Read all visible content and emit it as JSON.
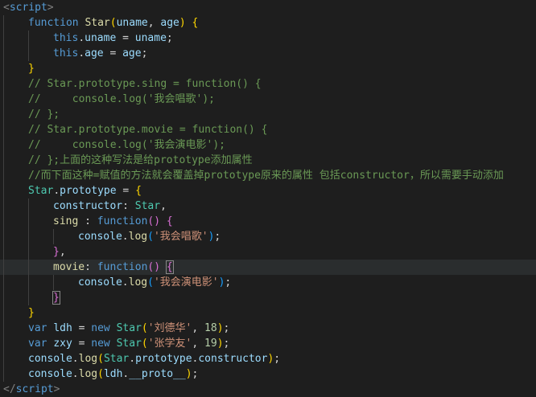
{
  "editor": {
    "language": "javascript",
    "lines": [
      {
        "indent": 0,
        "tokens": [
          [
            "tok-tag",
            "<"
          ],
          [
            "tok-tagname",
            "script"
          ],
          [
            "tok-tag",
            ">"
          ]
        ]
      },
      {
        "indent": 1,
        "tokens": [
          [
            "tok-kw",
            "function "
          ],
          [
            "tok-fn",
            "Star"
          ],
          [
            "tok-b1",
            "("
          ],
          [
            "tok-var",
            "uname"
          ],
          [
            "tok-pun",
            ", "
          ],
          [
            "tok-var",
            "age"
          ],
          [
            "tok-b1",
            ")"
          ],
          [
            "tok-pun",
            " "
          ],
          [
            "tok-b1",
            "{"
          ]
        ]
      },
      {
        "indent": 2,
        "tokens": [
          [
            "tok-kw",
            "this"
          ],
          [
            "tok-pun",
            "."
          ],
          [
            "tok-prop",
            "uname"
          ],
          [
            "tok-pun",
            " = "
          ],
          [
            "tok-var",
            "uname"
          ],
          [
            "tok-pun",
            ";"
          ]
        ]
      },
      {
        "indent": 2,
        "tokens": [
          [
            "tok-kw",
            "this"
          ],
          [
            "tok-pun",
            "."
          ],
          [
            "tok-prop",
            "age"
          ],
          [
            "tok-pun",
            " = "
          ],
          [
            "tok-var",
            "age"
          ],
          [
            "tok-pun",
            ";"
          ]
        ]
      },
      {
        "indent": 1,
        "tokens": [
          [
            "tok-b1",
            "}"
          ]
        ]
      },
      {
        "indent": 1,
        "tokens": [
          [
            "tok-cm",
            "// Star.prototype.sing = function() {"
          ]
        ]
      },
      {
        "indent": 1,
        "tokens": [
          [
            "tok-cm",
            "//     console.log('我会唱歌');"
          ]
        ]
      },
      {
        "indent": 1,
        "tokens": [
          [
            "tok-cm",
            "// };"
          ]
        ]
      },
      {
        "indent": 1,
        "tokens": [
          [
            "tok-cm",
            "// Star.prototype.movie = function() {"
          ]
        ]
      },
      {
        "indent": 1,
        "tokens": [
          [
            "tok-cm",
            "//     console.log('我会演电影');"
          ]
        ]
      },
      {
        "indent": 1,
        "tokens": [
          [
            "tok-cm",
            "// };上面的这种写法是给prototype添加属性"
          ]
        ]
      },
      {
        "indent": 1,
        "tokens": [
          [
            "tok-cm",
            "//而下面这种=赋值的方法就会覆盖掉prototype原来的属性 包括constructor，所以需要手动添加"
          ]
        ]
      },
      {
        "indent": 1,
        "tokens": [
          [
            "tok-cls",
            "Star"
          ],
          [
            "tok-pun",
            "."
          ],
          [
            "tok-prop",
            "prototype"
          ],
          [
            "tok-pun",
            " = "
          ],
          [
            "tok-b1",
            "{"
          ]
        ]
      },
      {
        "indent": 2,
        "tokens": [
          [
            "tok-prop",
            "constructor"
          ],
          [
            "tok-pun",
            ": "
          ],
          [
            "tok-cls",
            "Star"
          ],
          [
            "tok-pun",
            ","
          ]
        ]
      },
      {
        "indent": 2,
        "tokens": [
          [
            "tok-fn",
            "sing"
          ],
          [
            "tok-pun",
            " : "
          ],
          [
            "tok-kw",
            "function"
          ],
          [
            "tok-b2",
            "()"
          ],
          [
            "tok-pun",
            " "
          ],
          [
            "tok-b2",
            "{"
          ]
        ]
      },
      {
        "indent": 3,
        "tokens": [
          [
            "tok-var",
            "console"
          ],
          [
            "tok-pun",
            "."
          ],
          [
            "tok-fn",
            "log"
          ],
          [
            "tok-b3",
            "("
          ],
          [
            "tok-str",
            "'我会唱歌'"
          ],
          [
            "tok-b3",
            ")"
          ],
          [
            "tok-pun",
            ";"
          ]
        ]
      },
      {
        "indent": 2,
        "tokens": [
          [
            "tok-b2",
            "}"
          ],
          [
            "tok-pun",
            ","
          ]
        ]
      },
      {
        "indent": 2,
        "active": true,
        "tokens": [
          [
            "tok-fn",
            "movie"
          ],
          [
            "tok-pun",
            ": "
          ],
          [
            "tok-kw",
            "function"
          ],
          [
            "tok-b2",
            "()"
          ],
          [
            "tok-pun",
            " "
          ],
          [
            "tok-b2 cursor-box",
            "{"
          ]
        ]
      },
      {
        "indent": 3,
        "tokens": [
          [
            "tok-var",
            "console"
          ],
          [
            "tok-pun",
            "."
          ],
          [
            "tok-fn",
            "log"
          ],
          [
            "tok-b3",
            "("
          ],
          [
            "tok-str",
            "'我会演电影'"
          ],
          [
            "tok-b3",
            ")"
          ],
          [
            "tok-pun",
            ";"
          ]
        ]
      },
      {
        "indent": 2,
        "tokens": [
          [
            "tok-b2 cursor-box",
            "}"
          ]
        ]
      },
      {
        "indent": 1,
        "tokens": [
          [
            "tok-b1",
            "}"
          ]
        ]
      },
      {
        "indent": 1,
        "tokens": [
          [
            "tok-kw",
            "var "
          ],
          [
            "tok-var",
            "ldh"
          ],
          [
            "tok-pun",
            " = "
          ],
          [
            "tok-kw",
            "new "
          ],
          [
            "tok-cls",
            "Star"
          ],
          [
            "tok-b1",
            "("
          ],
          [
            "tok-str",
            "'刘德华'"
          ],
          [
            "tok-pun",
            ", "
          ],
          [
            "tok-num",
            "18"
          ],
          [
            "tok-b1",
            ")"
          ],
          [
            "tok-pun",
            ";"
          ]
        ]
      },
      {
        "indent": 1,
        "tokens": [
          [
            "tok-kw",
            "var "
          ],
          [
            "tok-var",
            "zxy"
          ],
          [
            "tok-pun",
            " = "
          ],
          [
            "tok-kw",
            "new "
          ],
          [
            "tok-cls",
            "Star"
          ],
          [
            "tok-b1",
            "("
          ],
          [
            "tok-str",
            "'张学友'"
          ],
          [
            "tok-pun",
            ", "
          ],
          [
            "tok-num",
            "19"
          ],
          [
            "tok-b1",
            ")"
          ],
          [
            "tok-pun",
            ";"
          ]
        ]
      },
      {
        "indent": 1,
        "tokens": [
          [
            "tok-var",
            "console"
          ],
          [
            "tok-pun",
            "."
          ],
          [
            "tok-fn",
            "log"
          ],
          [
            "tok-b1",
            "("
          ],
          [
            "tok-cls",
            "Star"
          ],
          [
            "tok-pun",
            "."
          ],
          [
            "tok-prop",
            "prototype"
          ],
          [
            "tok-pun",
            "."
          ],
          [
            "tok-prop",
            "constructor"
          ],
          [
            "tok-b1",
            ")"
          ],
          [
            "tok-pun",
            ";"
          ]
        ]
      },
      {
        "indent": 1,
        "tokens": [
          [
            "tok-var",
            "console"
          ],
          [
            "tok-pun",
            "."
          ],
          [
            "tok-fn",
            "log"
          ],
          [
            "tok-b1",
            "("
          ],
          [
            "tok-var",
            "ldh"
          ],
          [
            "tok-pun",
            "."
          ],
          [
            "tok-prop",
            "__proto__"
          ],
          [
            "tok-b1",
            ")"
          ],
          [
            "tok-pun",
            ";"
          ]
        ]
      },
      {
        "indent": 0,
        "tokens": [
          [
            "tok-tag",
            "</"
          ],
          [
            "tok-tagname",
            "script"
          ],
          [
            "tok-tag",
            ">"
          ]
        ]
      }
    ]
  }
}
